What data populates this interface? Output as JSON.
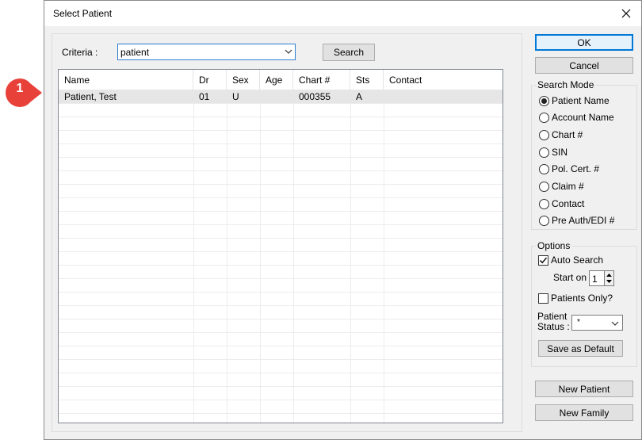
{
  "callout": {
    "number": "1",
    "color": "#e8413a"
  },
  "dialog": {
    "title": "Select Patient"
  },
  "criteria": {
    "label": "Criteria :",
    "value": "patient",
    "search_label": "Search"
  },
  "grid": {
    "columns": [
      "Name",
      "Dr",
      "Sex",
      "Age",
      "Chart #",
      "Sts",
      "Contact"
    ],
    "rows": [
      {
        "name": "Patient, Test",
        "dr": "01",
        "sex": "U",
        "age": "",
        "chart": "000355",
        "sts": "A",
        "contact": ""
      }
    ]
  },
  "buttons": {
    "ok": "OK",
    "cancel": "Cancel",
    "new_patient": "New Patient",
    "new_family": "New Family"
  },
  "search_mode": {
    "title": "Search Mode",
    "options": [
      "Patient Name",
      "Account Name",
      "Chart #",
      "SIN",
      "Pol. Cert. #",
      "Claim #",
      "Contact",
      "Pre Auth/EDI #"
    ],
    "selected": "Patient Name"
  },
  "options": {
    "title": "Options",
    "auto_search": {
      "label": "Auto Search",
      "checked": true
    },
    "start_on": {
      "label": "Start on",
      "value": "1"
    },
    "patients_only": {
      "label": "Patients Only?",
      "checked": false
    },
    "patient_status": {
      "label_line1": "Patient",
      "label_line2": "Status :",
      "value": "*"
    },
    "save_default": "Save as Default"
  }
}
